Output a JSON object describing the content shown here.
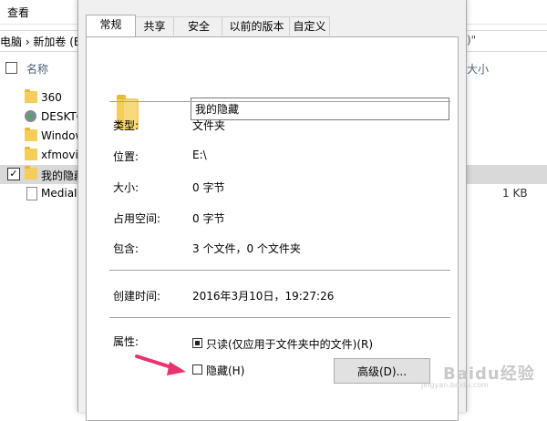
{
  "explorer": {
    "ribbon_tab": "查看",
    "address_left": "电脑 › 新加卷 (E",
    "address_right": ")\"",
    "columns": {
      "name": "名称",
      "size": "大小"
    },
    "files": [
      {
        "name": "360",
        "icon": "folder-icon",
        "size": "",
        "selected": false,
        "checked": false
      },
      {
        "name": "DESKTO",
        "icon": "network-icon",
        "size": "",
        "selected": false,
        "checked": false
      },
      {
        "name": "Window",
        "icon": "folder-icon",
        "size": "",
        "selected": false,
        "checked": false
      },
      {
        "name": "xfmovie",
        "icon": "folder-icon",
        "size": "",
        "selected": false,
        "checked": false
      },
      {
        "name": "我的隐藏",
        "icon": "folder-icon",
        "size": "",
        "selected": true,
        "checked": true
      },
      {
        "name": "MediaI",
        "icon": "document-icon",
        "size": "1 KB",
        "selected": false,
        "checked": false
      }
    ],
    "check_mark": "✓"
  },
  "dialog": {
    "tabs": [
      "常规",
      "共享",
      "安全",
      "以前的版本",
      "自定义"
    ],
    "active_tab": "常规",
    "folder_name": "我的隐藏",
    "properties": {
      "type_label": "类型:",
      "type_value": "文件夹",
      "location_label": "位置:",
      "location_value": "E:\\",
      "size_label": "大小:",
      "size_value": "0 字节",
      "size_on_disk_label": "占用空间:",
      "size_on_disk_value": "0 字节",
      "contains_label": "包含:",
      "contains_value": "3 个文件，0 个文件夹",
      "created_label": "创建时间:",
      "created_value": "2016年3月10日，19:27:26",
      "attributes_label": "属性:"
    },
    "attributes": {
      "readonly_label": "只读(仅应用于文件夹中的文件)(R)",
      "readonly_state": "indeterminate",
      "hidden_label": "隐藏(H)",
      "hidden_checked": false
    },
    "advanced_button": "高级(D)..."
  },
  "annotation": {
    "arrow_color": "#e8336e"
  },
  "watermark": {
    "text": "Baidu经验",
    "sub": "jingyan.baidu.com"
  }
}
